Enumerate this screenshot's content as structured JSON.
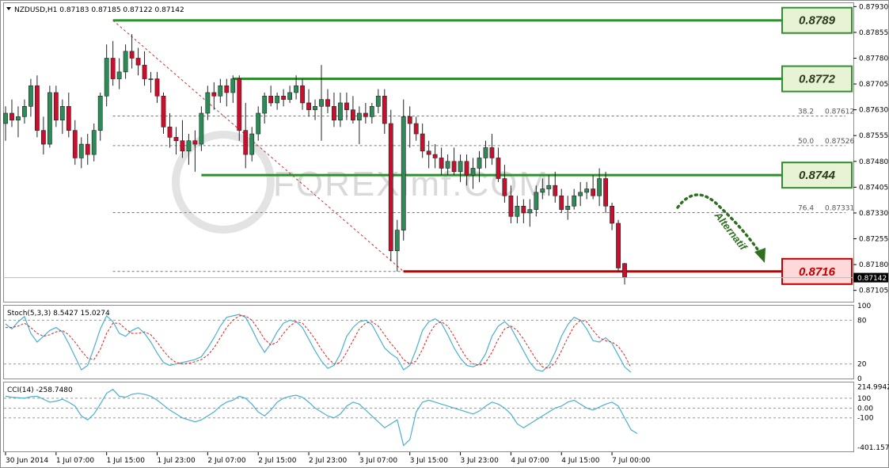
{
  "chart_data": {
    "type": "candlestick",
    "symbol_header": "NZDUSD,H1  0.87183 0.87185 0.87122 0.87142",
    "current_price_label": "0.87142",
    "watermark": "FOREXimf.COM",
    "annotation": "Alternatif",
    "colors": {
      "bull": "#2e8b57",
      "bear": "#c8102e",
      "support_line": "#2f8f2f",
      "resistance_line": "#c00000",
      "stoch_main": "#4ab0d0",
      "stoch_signal": "#e02020",
      "cci": "#4ab0d0",
      "fib_line": "#cc3333"
    },
    "price_axis": {
      "ylim": [
        0.87072,
        0.8794
      ],
      "ticks": [
        "0.87930",
        "0.87855",
        "0.87780",
        "0.87705",
        "0.87630",
        "0.87555",
        "0.87480",
        "0.87405",
        "0.87330",
        "0.87255",
        "0.87180",
        "0.87105"
      ]
    },
    "x_axis": {
      "ticks": [
        "30 Jun 2014",
        "1 Jul 07:00",
        "1 Jul 15:00",
        "1 Jul 23:00",
        "2 Jul 07:00",
        "2 Jul 15:00",
        "2 Jul 23:00",
        "3 Jul 07:00",
        "3 Jul 15:00",
        "3 Jul 23:00",
        "4 Jul 07:00",
        "4 Jul 15:00",
        "7 Jul 00:00"
      ],
      "tick_bar_index": [
        0,
        8,
        16,
        24,
        32,
        40,
        48,
        56,
        64,
        72,
        80,
        88,
        96
      ]
    },
    "levels": [
      {
        "label": "0.8789",
        "price": 0.8789,
        "kind": "support",
        "start_bar": 17
      },
      {
        "label": "0.8772",
        "price": 0.8772,
        "kind": "support",
        "start_bar": 36
      },
      {
        "label": "0.8744",
        "price": 0.8744,
        "kind": "support",
        "start_bar": 31
      },
      {
        "label": "0.8716",
        "price": 0.8716,
        "kind": "resistance",
        "start_bar": 63
      }
    ],
    "fibonacci": {
      "high": 0.8789,
      "low": 0.8716,
      "start_bar": 17,
      "line_from_bar": 17,
      "line_to_bar": 63,
      "levels": [
        {
          "ratio": "38.2",
          "value": "0.87612"
        },
        {
          "ratio": "50.0",
          "value": "0.87526"
        },
        {
          "ratio": "76.4",
          "value": "0.87331"
        }
      ]
    },
    "candles": [
      [
        0.8759,
        0.8764,
        0.8754,
        0.8762
      ],
      [
        0.8762,
        0.8766,
        0.8758,
        0.876
      ],
      [
        0.876,
        0.8764,
        0.8755,
        0.8761
      ],
      [
        0.8761,
        0.8766,
        0.8759,
        0.8764
      ],
      [
        0.8764,
        0.8772,
        0.8761,
        0.877
      ],
      [
        0.877,
        0.8773,
        0.8755,
        0.8757
      ],
      [
        0.8757,
        0.8761,
        0.875,
        0.8753
      ],
      [
        0.8753,
        0.877,
        0.8752,
        0.8768
      ],
      [
        0.8768,
        0.877,
        0.8758,
        0.876
      ],
      [
        0.876,
        0.8766,
        0.8756,
        0.8764
      ],
      [
        0.8764,
        0.8768,
        0.8755,
        0.8757
      ],
      [
        0.8757,
        0.876,
        0.8747,
        0.8749
      ],
      [
        0.8749,
        0.8755,
        0.8746,
        0.8753
      ],
      [
        0.8753,
        0.8756,
        0.8747,
        0.875
      ],
      [
        0.875,
        0.8759,
        0.8748,
        0.8757
      ],
      [
        0.8757,
        0.8768,
        0.8754,
        0.8767
      ],
      [
        0.8767,
        0.8782,
        0.8764,
        0.8778
      ],
      [
        0.8778,
        0.8783,
        0.877,
        0.8772
      ],
      [
        0.8772,
        0.8778,
        0.8769,
        0.8774
      ],
      [
        0.8774,
        0.8782,
        0.8772,
        0.878
      ],
      [
        0.878,
        0.8785,
        0.8775,
        0.8778
      ],
      [
        0.8778,
        0.8781,
        0.8773,
        0.8776
      ],
      [
        0.8776,
        0.878,
        0.877,
        0.8772
      ],
      [
        0.8772,
        0.8774,
        0.8768,
        0.8772
      ],
      [
        0.8772,
        0.8774,
        0.8765,
        0.8767
      ],
      [
        0.8767,
        0.8768,
        0.8756,
        0.8758
      ],
      [
        0.8758,
        0.8762,
        0.8752,
        0.8755
      ],
      [
        0.8755,
        0.8758,
        0.875,
        0.8754
      ],
      [
        0.8754,
        0.876,
        0.8749,
        0.8751
      ],
      [
        0.8751,
        0.8756,
        0.8747,
        0.8754
      ],
      [
        0.8754,
        0.8757,
        0.8745,
        0.8753
      ],
      [
        0.8753,
        0.8764,
        0.8751,
        0.8762
      ],
      [
        0.8762,
        0.877,
        0.876,
        0.8768
      ],
      [
        0.8768,
        0.8771,
        0.8763,
        0.8767
      ],
      [
        0.8767,
        0.8772,
        0.8765,
        0.877
      ],
      [
        0.877,
        0.8772,
        0.8764,
        0.8768
      ],
      [
        0.8768,
        0.8773,
        0.8765,
        0.8772
      ],
      [
        0.8772,
        0.8773,
        0.8754,
        0.8757
      ],
      [
        0.8757,
        0.8765,
        0.8746,
        0.875
      ],
      [
        0.875,
        0.8758,
        0.8748,
        0.8756
      ],
      [
        0.8756,
        0.8764,
        0.8754,
        0.8762
      ],
      [
        0.8762,
        0.8768,
        0.8759,
        0.8767
      ],
      [
        0.8767,
        0.877,
        0.8764,
        0.8765
      ],
      [
        0.8765,
        0.8768,
        0.8763,
        0.8767
      ],
      [
        0.8767,
        0.8769,
        0.8764,
        0.8766
      ],
      [
        0.8766,
        0.877,
        0.8765,
        0.8768
      ],
      [
        0.8768,
        0.8773,
        0.8766,
        0.877
      ],
      [
        0.877,
        0.8772,
        0.8763,
        0.8765
      ],
      [
        0.8765,
        0.8769,
        0.8761,
        0.8763
      ],
      [
        0.8763,
        0.8766,
        0.876,
        0.8764
      ],
      [
        0.8764,
        0.8776,
        0.8754,
        0.8766
      ],
      [
        0.8766,
        0.8769,
        0.8762,
        0.8764
      ],
      [
        0.8764,
        0.8768,
        0.8758,
        0.876
      ],
      [
        0.876,
        0.8768,
        0.8758,
        0.8765
      ],
      [
        0.8765,
        0.8768,
        0.876,
        0.8763
      ],
      [
        0.8763,
        0.8767,
        0.8759,
        0.876
      ],
      [
        0.876,
        0.8764,
        0.8753,
        0.8762
      ],
      [
        0.8762,
        0.8765,
        0.8759,
        0.8761
      ],
      [
        0.8761,
        0.8765,
        0.8759,
        0.8764
      ],
      [
        0.8764,
        0.8769,
        0.8762,
        0.8767
      ],
      [
        0.8767,
        0.8769,
        0.8756,
        0.8759
      ],
      [
        0.8759,
        0.8763,
        0.8719,
        0.8722
      ],
      [
        0.8722,
        0.8731,
        0.8716,
        0.8728
      ],
      [
        0.8728,
        0.8766,
        0.8725,
        0.8761
      ],
      [
        0.8761,
        0.8764,
        0.8752,
        0.8759
      ],
      [
        0.8759,
        0.8761,
        0.8754,
        0.8756
      ],
      [
        0.8756,
        0.8759,
        0.8749,
        0.8751
      ],
      [
        0.8751,
        0.8754,
        0.8746,
        0.875
      ],
      [
        0.875,
        0.8753,
        0.8746,
        0.8749
      ],
      [
        0.8749,
        0.8752,
        0.8744,
        0.8746
      ],
      [
        0.8746,
        0.875,
        0.8744,
        0.8748
      ],
      [
        0.8748,
        0.8752,
        0.8744,
        0.8745
      ],
      [
        0.8745,
        0.875,
        0.8742,
        0.8748
      ],
      [
        0.8748,
        0.875,
        0.8741,
        0.8744
      ],
      [
        0.8744,
        0.8749,
        0.874,
        0.8746
      ],
      [
        0.8746,
        0.8751,
        0.8742,
        0.8749
      ],
      [
        0.8749,
        0.8754,
        0.8746,
        0.8752
      ],
      [
        0.8752,
        0.8756,
        0.8747,
        0.8749
      ],
      [
        0.8749,
        0.8752,
        0.8742,
        0.8743
      ],
      [
        0.8743,
        0.8747,
        0.8736,
        0.8738
      ],
      [
        0.8738,
        0.8741,
        0.873,
        0.8732
      ],
      [
        0.8732,
        0.8738,
        0.873,
        0.8735
      ],
      [
        0.8735,
        0.8737,
        0.873,
        0.8733
      ],
      [
        0.8733,
        0.8737,
        0.8729,
        0.8734
      ],
      [
        0.8734,
        0.8741,
        0.8732,
        0.8739
      ],
      [
        0.8739,
        0.8743,
        0.8737,
        0.874
      ],
      [
        0.874,
        0.8744,
        0.8738,
        0.8741
      ],
      [
        0.8741,
        0.8745,
        0.8736,
        0.8738
      ],
      [
        0.8738,
        0.874,
        0.8733,
        0.8734
      ],
      [
        0.8734,
        0.8738,
        0.8731,
        0.8735
      ],
      [
        0.8735,
        0.874,
        0.8734,
        0.8738
      ],
      [
        0.8738,
        0.8742,
        0.8735,
        0.8739
      ],
      [
        0.8739,
        0.8742,
        0.8737,
        0.874
      ],
      [
        0.874,
        0.8744,
        0.8737,
        0.8738
      ],
      [
        0.8738,
        0.8746,
        0.8735,
        0.8743
      ],
      [
        0.8743,
        0.8745,
        0.8733,
        0.8735
      ],
      [
        0.8735,
        0.8736,
        0.8728,
        0.873
      ],
      [
        0.873,
        0.8731,
        0.8716,
        0.8717
      ],
      [
        0.87183,
        0.87185,
        0.87122,
        0.87142
      ]
    ],
    "stochastic": {
      "label": "Stoch(5,3,3) 8.5427 15.0274",
      "ylim": [
        0,
        100
      ],
      "ticks": [
        "100",
        "80",
        "20",
        "0"
      ],
      "levels": [
        80,
        20
      ],
      "main": [
        75,
        68,
        78,
        85,
        62,
        50,
        58,
        66,
        70,
        64,
        48,
        30,
        12,
        18,
        42,
        68,
        86,
        78,
        62,
        58,
        66,
        70,
        62,
        50,
        35,
        22,
        18,
        20,
        22,
        24,
        26,
        30,
        42,
        56,
        72,
        84,
        86,
        88,
        84,
        68,
        50,
        36,
        48,
        64,
        76,
        80,
        78,
        70,
        54,
        38,
        24,
        14,
        18,
        34,
        58,
        70,
        78,
        80,
        74,
        58,
        42,
        34,
        28,
        12,
        18,
        40,
        66,
        78,
        82,
        76,
        60,
        42,
        28,
        18,
        16,
        20,
        34,
        58,
        72,
        78,
        70,
        54,
        38,
        22,
        12,
        10,
        18,
        36,
        58,
        74,
        84,
        80,
        68,
        52,
        50,
        56,
        48,
        32,
        16,
        8.5
      ],
      "signal": [
        70,
        70,
        72,
        76,
        70,
        62,
        58,
        60,
        64,
        66,
        60,
        50,
        38,
        28,
        26,
        40,
        62,
        76,
        76,
        68,
        62,
        62,
        64,
        60,
        50,
        38,
        28,
        22,
        20,
        21,
        23,
        26,
        32,
        42,
        56,
        70,
        80,
        86,
        86,
        80,
        68,
        54,
        46,
        50,
        62,
        72,
        78,
        76,
        66,
        54,
        40,
        28,
        20,
        22,
        36,
        52,
        68,
        76,
        78,
        72,
        60,
        48,
        38,
        26,
        20,
        24,
        40,
        60,
        74,
        78,
        72,
        58,
        42,
        28,
        20,
        18,
        22,
        36,
        54,
        68,
        72,
        66,
        54,
        40,
        26,
        16,
        14,
        22,
        38,
        56,
        72,
        80,
        78,
        66,
        56,
        52,
        50,
        44,
        32,
        15
      ]
    },
    "cci": {
      "label": "CCI(14) -258.7480",
      "ylim": [
        -440,
        260
      ],
      "ticks": [
        "214.9942",
        "100",
        "0.00",
        "-100",
        "-401.1573"
      ],
      "levels": [
        100,
        0,
        -100
      ],
      "values": [
        120,
        110,
        105,
        100,
        115,
        120,
        90,
        60,
        70,
        90,
        60,
        20,
        -80,
        -120,
        -60,
        40,
        150,
        190,
        120,
        110,
        140,
        150,
        140,
        120,
        80,
        30,
        -20,
        -60,
        -100,
        -120,
        -140,
        -120,
        -80,
        -40,
        20,
        60,
        80,
        120,
        100,
        40,
        -40,
        -80,
        -20,
        60,
        100,
        120,
        130,
        110,
        60,
        0,
        -40,
        -80,
        -100,
        -60,
        20,
        60,
        40,
        -20,
        -80,
        -140,
        -200,
        -160,
        -120,
        -380,
        -320,
        -40,
        60,
        80,
        60,
        40,
        20,
        0,
        -20,
        -40,
        -60,
        -30,
        20,
        60,
        40,
        0,
        -60,
        -160,
        -200,
        -160,
        -120,
        -80,
        -40,
        0,
        20,
        60,
        80,
        40,
        0,
        -20,
        10,
        40,
        60,
        20,
        -100,
        -220,
        -258.7
      ]
    }
  }
}
